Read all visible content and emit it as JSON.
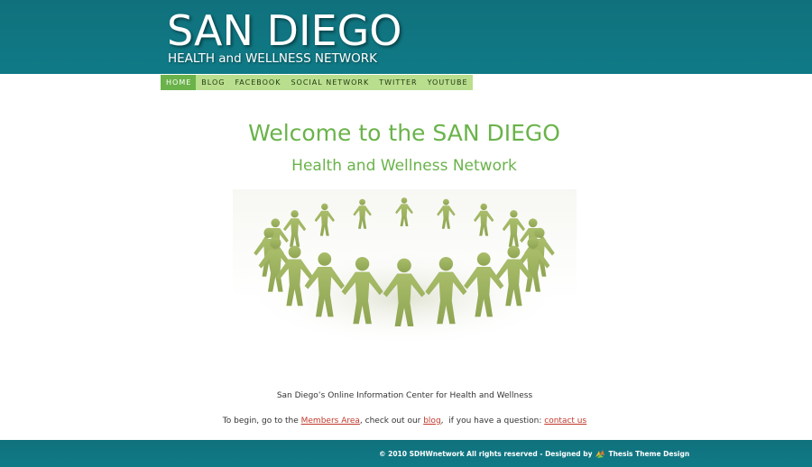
{
  "header": {
    "title": "SAN DIEGO",
    "subtitle": "HEALTH and WELLNESS NETWORK"
  },
  "nav": {
    "items": [
      {
        "label": "HOME",
        "active": true
      },
      {
        "label": "BLOG",
        "active": false
      },
      {
        "label": "FACEBOOK",
        "active": false
      },
      {
        "label": "SOCIAL NETWORK",
        "active": false
      },
      {
        "label": "TWITTER",
        "active": false
      },
      {
        "label": "YOUTUBE",
        "active": false
      }
    ]
  },
  "main": {
    "welcome_title": "Welcome to the SAN DIEGO",
    "welcome_subtitle": "Health and Wellness Network",
    "hero_image_icon": "people-circle-illustration",
    "tagline": "San Diego’s Online Information Center for Health and Wellness",
    "intro": {
      "prefix": "To begin, go to the ",
      "members_link": "Members Area",
      "middle": ", check out our ",
      "blog_link": "blog",
      "middle2": ",  if you have a question: ",
      "contact_link": "contact us"
    }
  },
  "footer": {
    "copyright": "© 2010 SDHWnetwork All rights reserved - Designed by",
    "designer_link": "Thesis Theme Design",
    "designer_icon": "thesis-logo-icon"
  },
  "colors": {
    "header_bg": "#0f7a86",
    "nav_bg": "#b9de8e",
    "nav_active": "#6ab34a",
    "heading_green": "#6ab34a",
    "link_red": "#c0392b",
    "figure_green": "#98ad5a"
  }
}
